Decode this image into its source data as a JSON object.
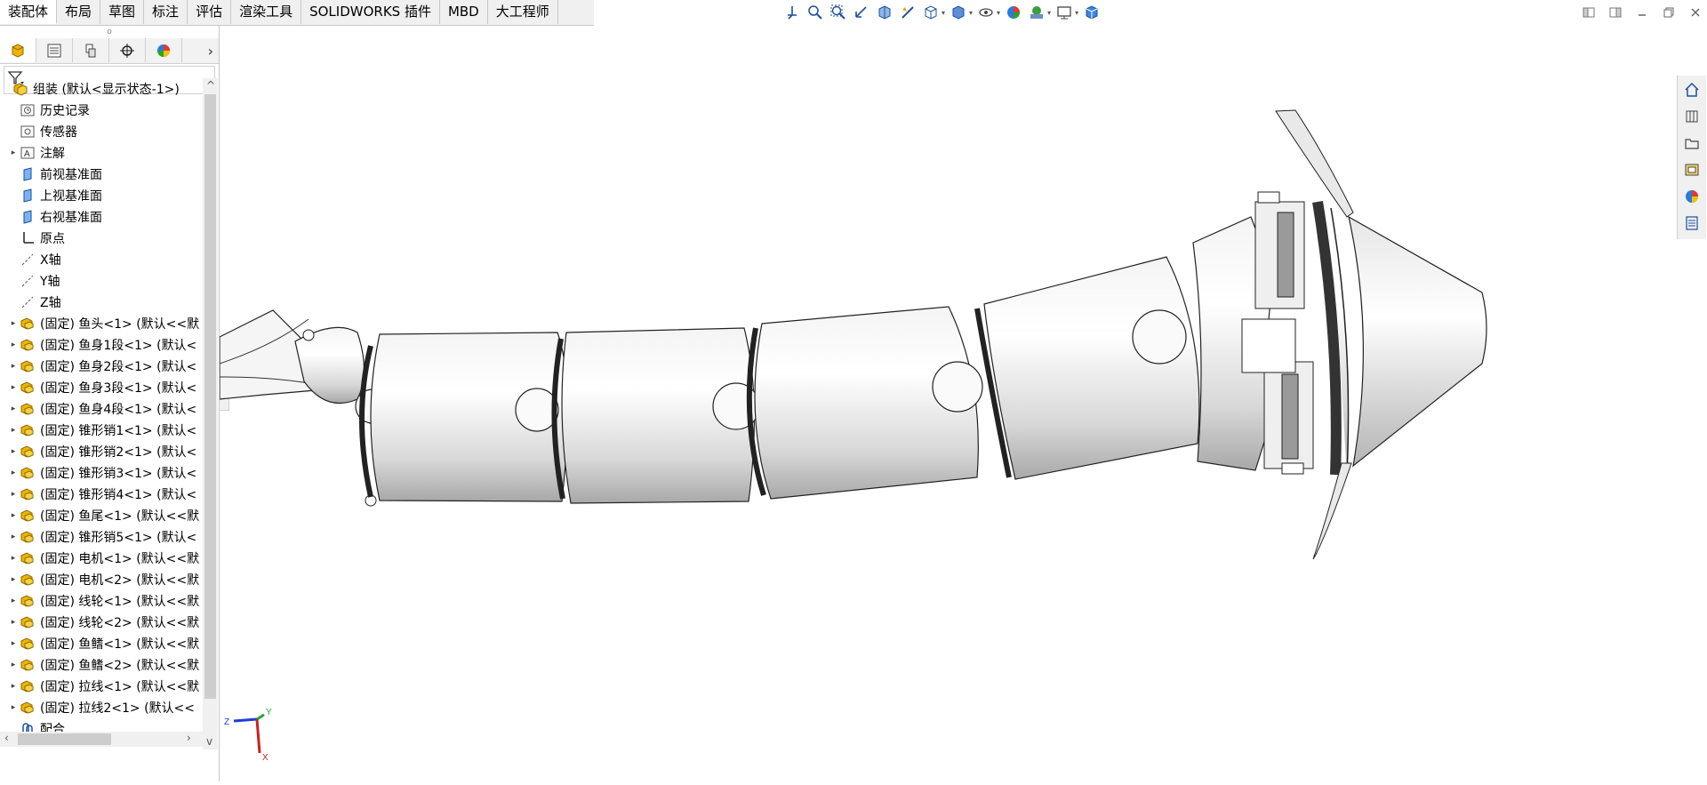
{
  "tabs": [
    "装配体",
    "布局",
    "草图",
    "标注",
    "评估",
    "渲染工具",
    "SOLIDWORKS 插件",
    "MBD",
    "大工程师"
  ],
  "active_tab": 0,
  "toolbar_icons": [
    "view-orientation-icon",
    "zoom-to-fit-icon",
    "zoom-area-icon",
    "previous-view-icon",
    "section-view-icon",
    "dynamic-annotation-icon",
    "view-setting-icon",
    "display-style-icon",
    "hide-show-icon",
    "edit-appearance-icon",
    "apply-scene-icon",
    "view-monitor-icon",
    "cube-icon"
  ],
  "panel_tabs": [
    "feature-manager-icon",
    "property-manager-icon",
    "configuration-manager-icon",
    "dim-xpert-icon",
    "display-manager-icon"
  ],
  "tree": [
    {
      "label": "组装  (默认<显示状态-1>)",
      "icon": "assembly",
      "expander": false,
      "level": 0
    },
    {
      "label": "历史记录",
      "icon": "history",
      "expander": false,
      "level": 1
    },
    {
      "label": "传感器",
      "icon": "sensor",
      "expander": false,
      "level": 1
    },
    {
      "label": "注解",
      "icon": "annotation",
      "expander": true,
      "level": 1
    },
    {
      "label": "前视基准面",
      "icon": "plane",
      "expander": false,
      "level": 1
    },
    {
      "label": "上视基准面",
      "icon": "plane",
      "expander": false,
      "level": 1
    },
    {
      "label": "右视基准面",
      "icon": "plane",
      "expander": false,
      "level": 1
    },
    {
      "label": "原点",
      "icon": "origin",
      "expander": false,
      "level": 1
    },
    {
      "label": "X轴",
      "icon": "axis",
      "expander": false,
      "level": 1
    },
    {
      "label": "Y轴",
      "icon": "axis",
      "expander": false,
      "level": 1
    },
    {
      "label": "Z轴",
      "icon": "axis",
      "expander": false,
      "level": 1
    },
    {
      "label": "(固定) 鱼头<1> (默认<<默",
      "icon": "part",
      "expander": true,
      "level": 1
    },
    {
      "label": "(固定) 鱼身1段<1> (默认<",
      "icon": "part",
      "expander": true,
      "level": 1
    },
    {
      "label": "(固定) 鱼身2段<1> (默认<",
      "icon": "part",
      "expander": true,
      "level": 1
    },
    {
      "label": "(固定) 鱼身3段<1> (默认<",
      "icon": "part",
      "expander": true,
      "level": 1
    },
    {
      "label": "(固定) 鱼身4段<1> (默认<",
      "icon": "part",
      "expander": true,
      "level": 1
    },
    {
      "label": "(固定) 锥形销1<1> (默认<",
      "icon": "part",
      "expander": true,
      "level": 1
    },
    {
      "label": "(固定) 锥形销2<1> (默认<",
      "icon": "part",
      "expander": true,
      "level": 1
    },
    {
      "label": "(固定) 锥形销3<1> (默认<",
      "icon": "part",
      "expander": true,
      "level": 1
    },
    {
      "label": "(固定) 锥形销4<1> (默认<",
      "icon": "part",
      "expander": true,
      "level": 1
    },
    {
      "label": "(固定) 鱼尾<1> (默认<<默",
      "icon": "part",
      "expander": true,
      "level": 1
    },
    {
      "label": "(固定) 锥形销5<1> (默认<",
      "icon": "part",
      "expander": true,
      "level": 1
    },
    {
      "label": "(固定) 电机<1> (默认<<默",
      "icon": "part",
      "expander": true,
      "level": 1
    },
    {
      "label": "(固定) 电机<2> (默认<<默",
      "icon": "part",
      "expander": true,
      "level": 1
    },
    {
      "label": "(固定) 线轮<1> (默认<<默",
      "icon": "part",
      "expander": true,
      "level": 1
    },
    {
      "label": "(固定) 线轮<2> (默认<<默",
      "icon": "part",
      "expander": true,
      "level": 1
    },
    {
      "label": "(固定) 鱼鳍<1> (默认<<默",
      "icon": "part",
      "expander": true,
      "level": 1
    },
    {
      "label": "(固定) 鱼鳍<2> (默认<<默",
      "icon": "part",
      "expander": true,
      "level": 1
    },
    {
      "label": "(固定) 拉线<1> (默认<<默",
      "icon": "part",
      "expander": true,
      "level": 1
    },
    {
      "label": "(固定) 拉线2<1> (默认<<",
      "icon": "part",
      "expander": true,
      "level": 1
    },
    {
      "label": "配合",
      "icon": "mate",
      "expander": false,
      "level": 1
    }
  ],
  "triad": {
    "z": "Z",
    "y": "Y",
    "x": "X"
  },
  "colors": {
    "accent": "#1a6fd1",
    "folder": "#f0b400",
    "triad_z": "#1c3fd8",
    "triad_y": "#28a528",
    "triad_x": "#cc2020"
  }
}
